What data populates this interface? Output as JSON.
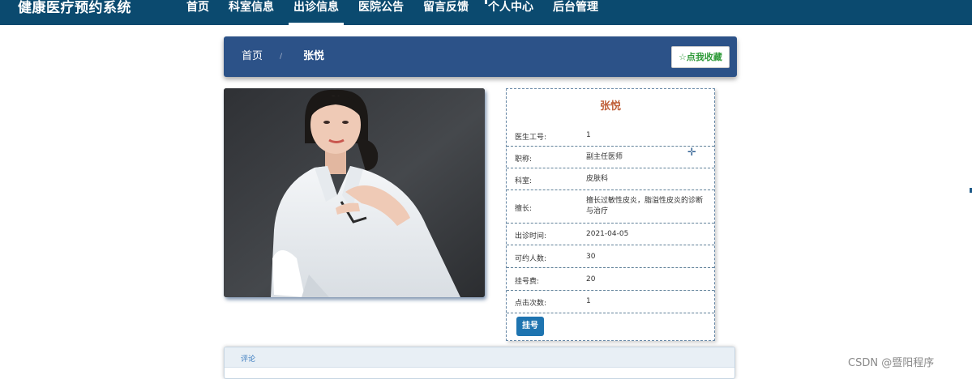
{
  "header": {
    "brand": "健康医疗预约系统",
    "nav": [
      "首页",
      "科室信息",
      "出诊信息",
      "医院公告",
      "留言反馈",
      "个人中心",
      "后台管理"
    ],
    "active_index": 2
  },
  "breadcrumb": {
    "home": "首页",
    "separator": "/",
    "current": "张悦",
    "favorite_label": "☆点我收藏"
  },
  "doctor": {
    "name": "张悦",
    "fields": [
      {
        "label": "医生工号:",
        "value": "1"
      },
      {
        "label": "职称:",
        "value": "副主任医师"
      },
      {
        "label": "科室:",
        "value": "皮肤科"
      },
      {
        "label": "擅长:",
        "value": "擅长过敏性皮炎，脂溢性皮炎的诊断与治疗"
      },
      {
        "label": "出诊时间:",
        "value": "2021-04-05"
      },
      {
        "label": "可约人数:",
        "value": "30"
      },
      {
        "label": "挂号费:",
        "value": "20"
      },
      {
        "label": "点击次数:",
        "value": "1"
      }
    ],
    "book_button": "挂号"
  },
  "comments": {
    "title": "评论"
  },
  "watermark": "CSDN @暨阳程序",
  "colors": {
    "topbar": "#0b4a6f",
    "breadcrumb_bar": "#2c5288",
    "name_accent": "#c0603a",
    "book_button": "#1e74b0",
    "favorite_text": "#2e9a38"
  }
}
